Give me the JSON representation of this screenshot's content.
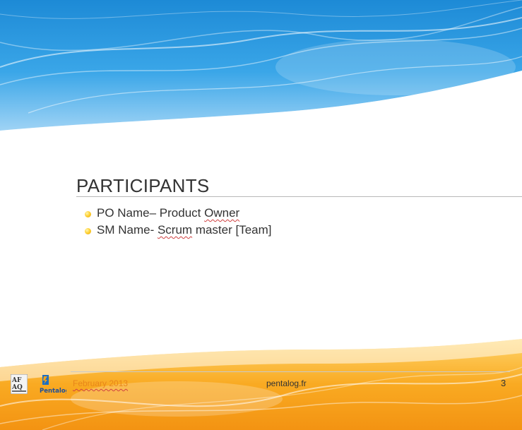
{
  "slide": {
    "title": "PARTICIPANTS",
    "bullets": [
      {
        "parts": [
          {
            "text": "PO Name– Product "
          },
          {
            "text": "Owner",
            "spell": true
          },
          {
            "text": " "
          }
        ]
      },
      {
        "parts": [
          {
            "text": "SM Name- "
          },
          {
            "text": "Scrum",
            "spell": true
          },
          {
            "text": " master [Team]"
          }
        ]
      }
    ]
  },
  "footer": {
    "date": "February 2013",
    "website": "pentalog.fr",
    "page_number": "3"
  },
  "logos": {
    "left_logo_text": "AFAQ",
    "right_logo_text": "Pentalog"
  },
  "colors": {
    "title_text": "#333333",
    "footer_date": "#e8861a",
    "header_blue": "#1e8fd8",
    "footer_orange": "#f7a21a"
  }
}
